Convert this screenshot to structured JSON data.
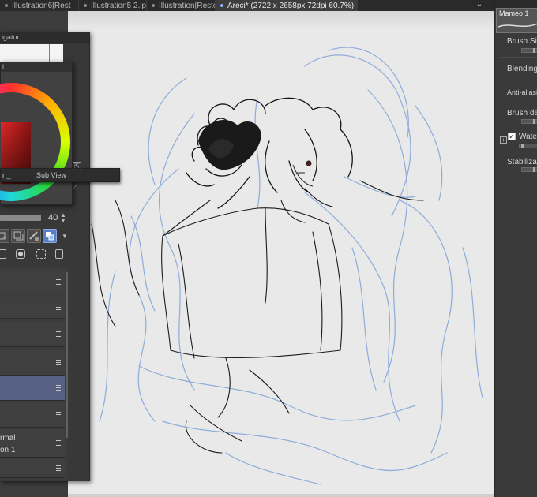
{
  "tabs": [
    {
      "label": "Illustration6[Rest",
      "active": false
    },
    {
      "label": "Illustration5 2.jp",
      "active": false
    },
    {
      "label": "Illustration[Resto",
      "active": false
    },
    {
      "label": "Areci* (2722 x 2658px 72dpi 60.7%)",
      "active": true
    }
  ],
  "tab_overflow_icon": "chevron-down-icon",
  "navigator": {
    "title": "igator"
  },
  "color_panel": {
    "title": "l"
  },
  "subview": {
    "label": "Sub View",
    "code": "r _"
  },
  "layer_opacity": {
    "value": "40",
    "fraction": 0.4
  },
  "layer_modes": [
    "clipping-icon",
    "reference-icon",
    "lock-transparent-icon",
    "draft-icon",
    "mask-icon"
  ],
  "layer_actions": [
    "new-layer-icon",
    "mask-icon",
    "copy-icon",
    "delete-icon"
  ],
  "layers": [
    {
      "name": "",
      "selected": false
    },
    {
      "name": "",
      "selected": false
    },
    {
      "name": "",
      "selected": false
    },
    {
      "name": "",
      "selected": false
    },
    {
      "name": "",
      "selected": true
    },
    {
      "name": "",
      "selected": false
    },
    {
      "name": "rmal",
      "selected": false
    },
    {
      "name": "on 1",
      "selected": false
    }
  ],
  "tool_property": {
    "brush_name": "Mameo 1",
    "brush_size": "Brush Siz",
    "blending": "Blending",
    "anti_aliasing": "Anti-aliasing",
    "brush_density": "Brush den",
    "watercolor": "Water",
    "stabilization": "Stabilizatio",
    "watercolor_checked": "✓"
  },
  "colors": {
    "accent": "#566184",
    "tab_active_dot": "#8fb6ff",
    "canvas": "#e9e9e9"
  }
}
